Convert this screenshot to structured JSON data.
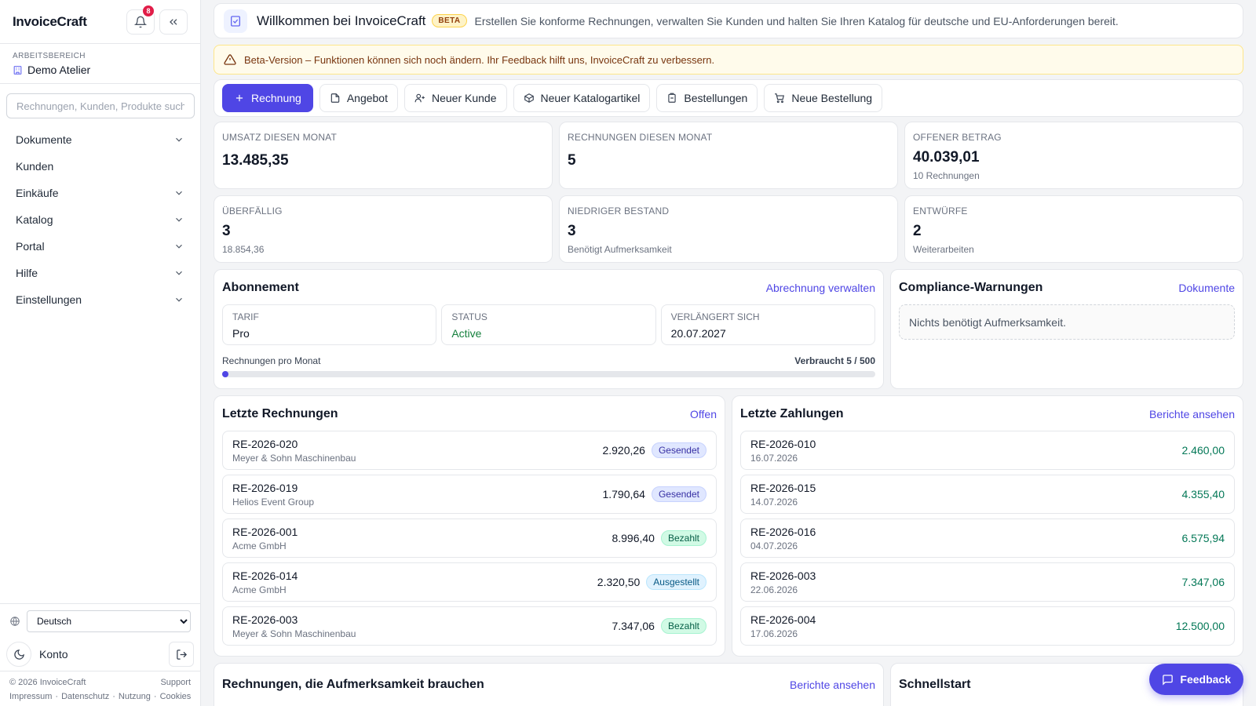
{
  "app": {
    "name": "InvoiceCraft",
    "notification_count": "8"
  },
  "workspace": {
    "label": "ARBEITSBEREICH",
    "name": "Demo Atelier"
  },
  "search": {
    "placeholder": "Rechnungen, Kunden, Produkte suchen"
  },
  "sidebar": {
    "items": [
      {
        "label": "Dokumente",
        "chevron": true
      },
      {
        "label": "Kunden",
        "chevron": false
      },
      {
        "label": "Einkäufe",
        "chevron": true
      },
      {
        "label": "Katalog",
        "chevron": true
      },
      {
        "label": "Portal",
        "chevron": true
      },
      {
        "label": "Hilfe",
        "chevron": true
      },
      {
        "label": "Einstellungen",
        "chevron": true
      }
    ],
    "language": "Deutsch",
    "account_label": "Konto",
    "copyright": "© 2026 InvoiceCraft",
    "support": "Support",
    "footer_links": [
      "Impressum",
      "Datenschutz",
      "Nutzung",
      "Cookies"
    ],
    "footer_sep": "·"
  },
  "welcome": {
    "title": "Willkommen bei InvoiceCraft",
    "badge": "BETA",
    "description": "Erstellen Sie konforme Rechnungen, verwalten Sie Kunden und halten Sie Ihren Katalog für deutsche und EU-Anforderungen bereit."
  },
  "beta_notice": "Beta-Version – Funktionen können sich noch ändern. Ihr Feedback hilft uns, InvoiceCraft zu verbessern.",
  "actions": {
    "invoice": "Rechnung",
    "quote": "Angebot",
    "new_customer": "Neuer Kunde",
    "new_catalog_item": "Neuer Katalogartikel",
    "orders": "Bestellungen",
    "new_order": "Neue Bestellung"
  },
  "stats": [
    {
      "label": "Umsatz diesen Monat",
      "value": "13.485,35",
      "sub": ""
    },
    {
      "label": "Rechnungen diesen Monat",
      "value": "5",
      "sub": ""
    },
    {
      "label": "Offener Betrag",
      "value": "40.039,01",
      "sub": "10 Rechnungen"
    },
    {
      "label": "Überfällig",
      "value": "3",
      "sub": "18.854,36"
    },
    {
      "label": "Niedriger Bestand",
      "value": "3",
      "sub": "Benötigt Aufmerksamkeit"
    },
    {
      "label": "Entwürfe",
      "value": "2",
      "sub": "Weiterarbeiten"
    }
  ],
  "subscription": {
    "title": "Abonnement",
    "manage_link": "Abrechnung verwalten",
    "plan_label": "TARIF",
    "plan": "Pro",
    "status_label": "STATUS",
    "status": "Active",
    "renews_label": "VERLÄNGERT SICH",
    "renews": "20.07.2027",
    "usage_label": "Rechnungen pro Monat",
    "usage_text": "Verbraucht 5 / 500",
    "usage_fraction": 0.01,
    "status_color": "#15803d",
    "accent_color": "#4f46e5"
  },
  "compliance": {
    "title": "Compliance-Warnungen",
    "link": "Dokumente",
    "empty": "Nichts benötigt Aufmerksamkeit."
  },
  "recent_invoices": {
    "title": "Letzte Rechnungen",
    "link": "Offen",
    "items": [
      {
        "id": "RE-2026-020",
        "customer": "Meyer & Sohn Maschinenbau",
        "amount": "2.920,26",
        "status": "Gesendet",
        "status_kind": "sent"
      },
      {
        "id": "RE-2026-019",
        "customer": "Helios Event Group",
        "amount": "1.790,64",
        "status": "Gesendet",
        "status_kind": "sent"
      },
      {
        "id": "RE-2026-001",
        "customer": "Acme GmbH",
        "amount": "8.996,40",
        "status": "Bezahlt",
        "status_kind": "paid"
      },
      {
        "id": "RE-2026-014",
        "customer": "Acme GmbH",
        "amount": "2.320,50",
        "status": "Ausgestellt",
        "status_kind": "issued"
      },
      {
        "id": "RE-2026-003",
        "customer": "Meyer & Sohn Maschinenbau",
        "amount": "7.347,06",
        "status": "Bezahlt",
        "status_kind": "paid"
      }
    ]
  },
  "recent_payments": {
    "title": "Letzte Zahlungen",
    "link": "Berichte ansehen",
    "items": [
      {
        "id": "RE-2026-010",
        "date": "16.07.2026",
        "amount": "2.460,00"
      },
      {
        "id": "RE-2026-015",
        "date": "14.07.2026",
        "amount": "4.355,40"
      },
      {
        "id": "RE-2026-016",
        "date": "04.07.2026",
        "amount": "6.575,94"
      },
      {
        "id": "RE-2026-003",
        "date": "22.06.2026",
        "amount": "7.347,06"
      },
      {
        "id": "RE-2026-004",
        "date": "17.06.2026",
        "amount": "12.500,00"
      }
    ]
  },
  "attention": {
    "title": "Rechnungen, die Aufmerksamkeit brauchen",
    "link": "Berichte ansehen"
  },
  "quickstart": {
    "title": "Schnellstart"
  },
  "feedback_label": "Feedback"
}
